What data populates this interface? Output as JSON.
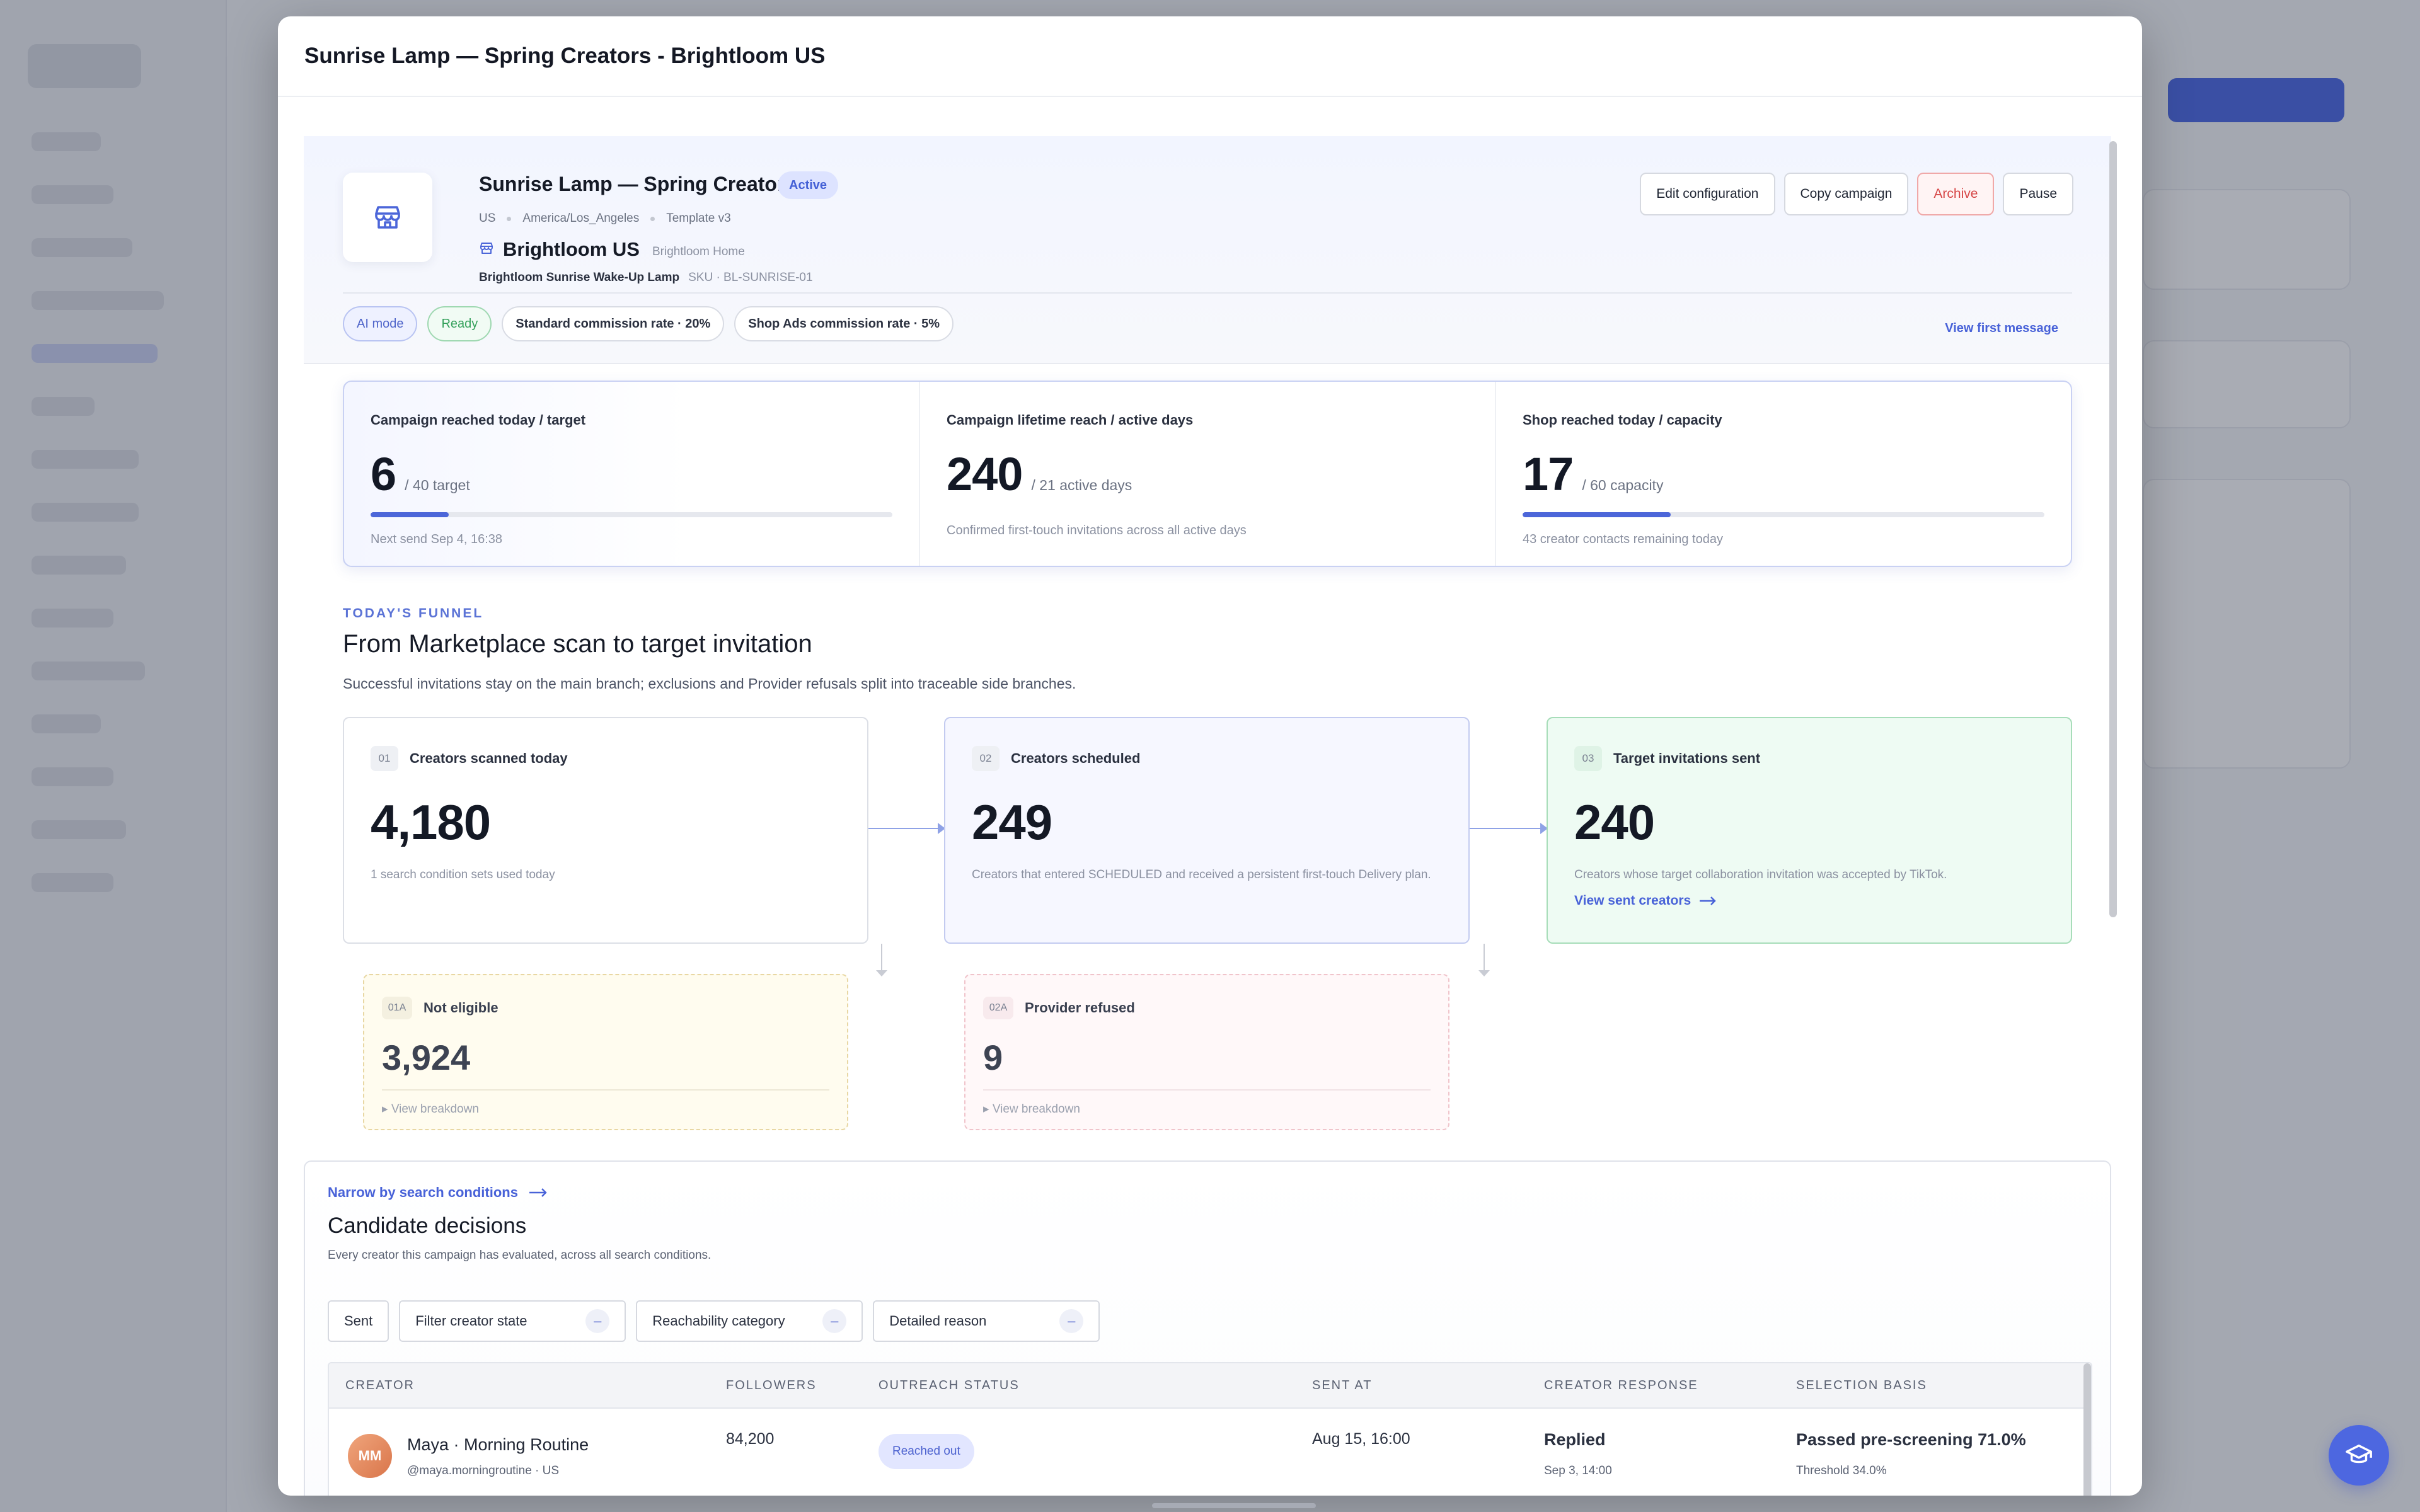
{
  "modal": {
    "title": "Sunrise Lamp — Spring Creators - Brightloom US"
  },
  "campaign": {
    "name": "Sunrise Lamp — Spring Creators",
    "status": "Active",
    "region": "US",
    "timezone": "America/Los_Angeles",
    "template": "Template v3",
    "shop_name": "Brightloom US",
    "shop_brand": "Brightloom Home",
    "product_name": "Brightloom Sunrise Wake-Up Lamp",
    "product_sku": "SKU · BL-SUNRISE-01"
  },
  "actions": {
    "edit": "Edit configuration",
    "copy": "Copy campaign",
    "archive": "Archive",
    "pause": "Pause"
  },
  "chips": {
    "ai_mode": "AI mode",
    "ready": "Ready",
    "standard_commission": "Standard commission rate · 20%",
    "shop_ads_commission": "Shop Ads commission rate · 5%"
  },
  "view_first_message": "View first message",
  "stats": [
    {
      "label": "Campaign reached today / target",
      "value": "6",
      "sub": "/ 40 target",
      "progress": 0.15,
      "note": "Next send Sep 4, 16:38"
    },
    {
      "label": "Campaign lifetime reach / active days",
      "value": "240",
      "sub": "/ 21 active days",
      "note": "Confirmed first-touch invitations across all active days"
    },
    {
      "label": "Shop reached today / capacity",
      "value": "17",
      "sub": "/ 60 capacity",
      "progress": 0.2833,
      "note": "43 creator contacts remaining today"
    }
  ],
  "funnel": {
    "eyebrow": "TODAY'S FUNNEL",
    "title": "From Marketplace scan to target invitation",
    "desc": "Successful invitations stay on the main branch; exclusions and Provider refusals split into traceable side branches.",
    "cards": [
      {
        "step": "01",
        "label": "Creators scanned today",
        "value": "4,180",
        "note": "1 search condition sets used today"
      },
      {
        "step": "02",
        "label": "Creators scheduled",
        "value": "249",
        "note": "Creators that entered SCHEDULED and received a persistent first-touch Delivery plan."
      },
      {
        "step": "03",
        "label": "Target invitations sent",
        "value": "240",
        "note": "Creators whose target collaboration invitation was accepted by TikTok.",
        "link": "View sent creators"
      }
    ],
    "branches": [
      {
        "step": "01A",
        "label": "Not eligible",
        "value": "3,924",
        "link": "▸ View breakdown"
      },
      {
        "step": "02A",
        "label": "Provider refused",
        "value": "9",
        "link": "▸ View breakdown"
      }
    ]
  },
  "candidates": {
    "narrow_link": "Narrow by search conditions",
    "title": "Candidate decisions",
    "desc": "Every creator this campaign has evaluated, across all search conditions.",
    "filters": {
      "sent": "Sent",
      "creator_state": "Filter creator state",
      "reachability": "Reachability category",
      "reason": "Detailed reason"
    },
    "columns": {
      "creator": "CREATOR",
      "followers": "FOLLOWERS",
      "outreach": "OUTREACH STATUS",
      "sent_at": "SENT AT",
      "response": "CREATOR RESPONSE",
      "basis": "SELECTION BASIS"
    },
    "rows": [
      {
        "initials": "MM",
        "name": "Maya · Morning Routine",
        "handle": "@maya.morningroutine · US",
        "followers": "84,200",
        "status": "Reached out",
        "sent_at": "Aug 15, 16:00",
        "response": "Replied",
        "response_time": "Sep 3, 14:00",
        "basis": "Passed pre-screening 71.0%",
        "threshold": "Threshold 34.0%"
      }
    ]
  },
  "colors": {
    "accent": "#4c66d9",
    "success": "#33a05a",
    "danger": "#d64545"
  },
  "icons": {
    "store": "store-icon",
    "help": "graduation-cap-icon",
    "arrow": "arrow-right-icon"
  }
}
